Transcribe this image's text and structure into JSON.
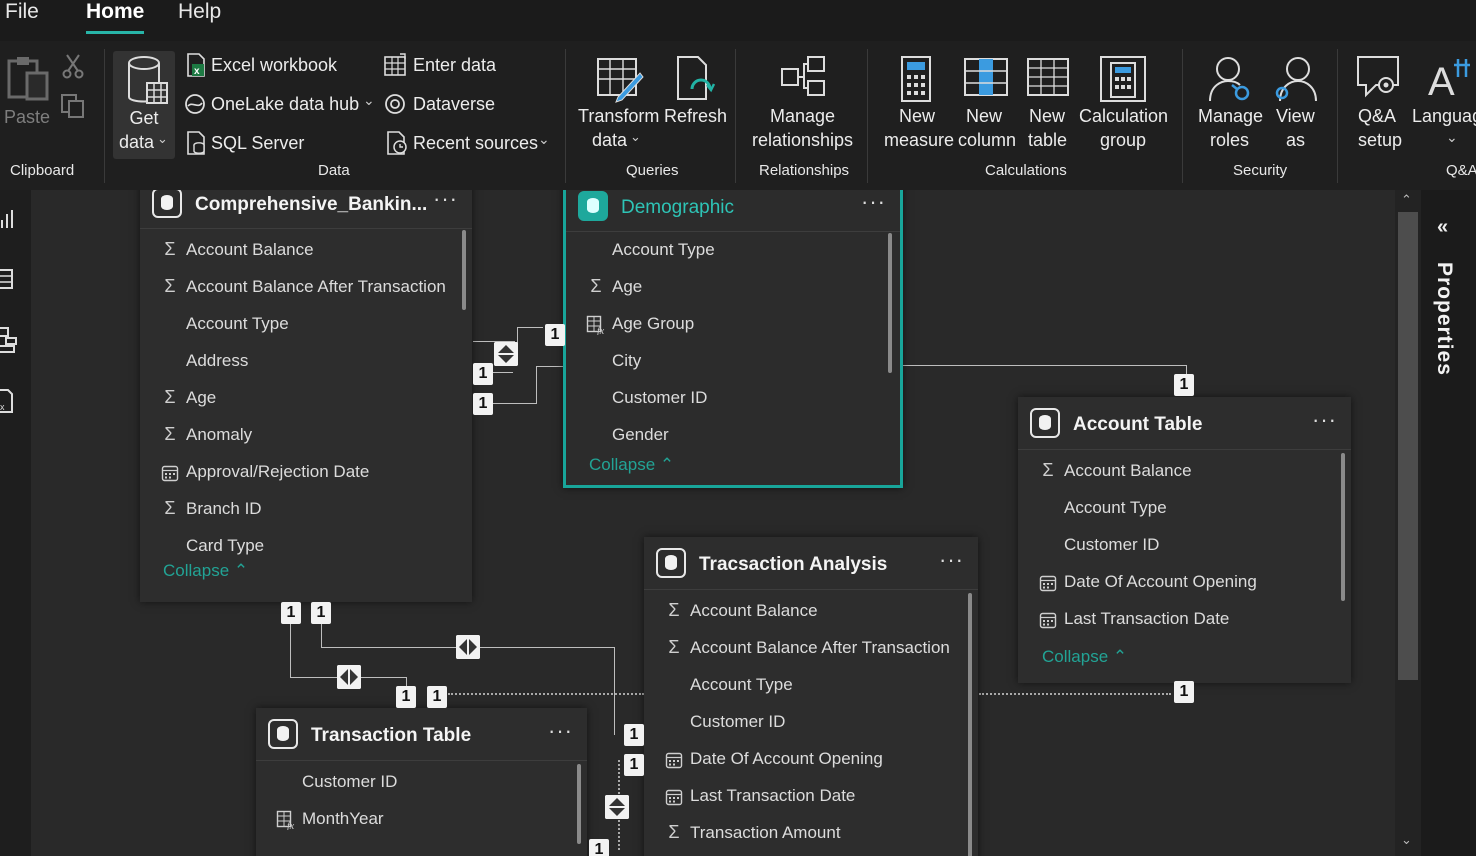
{
  "menu": {
    "file": "File",
    "home": "Home",
    "help": "Help"
  },
  "ribbon": {
    "clipboard": {
      "paste": "Paste",
      "label": "Clipboard"
    },
    "data": {
      "get_data_1": "Get",
      "get_data_2": "data",
      "excel": "Excel workbook",
      "onelake": "OneLake data hub",
      "sql": "SQL Server",
      "enter": "Enter data",
      "dataverse": "Dataverse",
      "recent": "Recent sources",
      "label": "Data"
    },
    "queries": {
      "transform_1": "Transform",
      "transform_2": "data",
      "refresh": "Refresh",
      "label": "Queries"
    },
    "relationships": {
      "manage_1": "Manage",
      "manage_2": "relationships",
      "label": "Relationships"
    },
    "calculations": {
      "new_measure_1": "New",
      "new_measure_2": "measure",
      "new_column_1": "New",
      "new_column_2": "column",
      "new_table_1": "New",
      "new_table_2": "table",
      "calc_group_1": "Calculation",
      "calc_group_2": "group",
      "label": "Calculations"
    },
    "security": {
      "manage_roles_1": "Manage",
      "manage_roles_2": "roles",
      "view_as_1": "View",
      "view_as_2": "as",
      "label": "Security"
    },
    "qa": {
      "qa_setup_1": "Q&A",
      "qa_setup_2": "setup",
      "language": "Languag",
      "label": "Q&A"
    }
  },
  "properties_label": "Properties",
  "tables": {
    "comprehensive": {
      "title": "Comprehensive_Bankin...",
      "fields": [
        {
          "icon": "sigma",
          "name": "Account Balance"
        },
        {
          "icon": "sigma",
          "name": "Account Balance After Transaction"
        },
        {
          "icon": "none",
          "name": "Account Type"
        },
        {
          "icon": "none",
          "name": "Address"
        },
        {
          "icon": "sigma",
          "name": "Age"
        },
        {
          "icon": "sigma",
          "name": "Anomaly"
        },
        {
          "icon": "calendar",
          "name": "Approval/Rejection Date"
        },
        {
          "icon": "sigma",
          "name": "Branch ID"
        },
        {
          "icon": "none",
          "name": "Card Type"
        }
      ],
      "collapse": "Collapse"
    },
    "demographic": {
      "title": "Demographic",
      "fields": [
        {
          "icon": "none",
          "name": "Account Type"
        },
        {
          "icon": "sigma",
          "name": "Age"
        },
        {
          "icon": "calc-column",
          "name": "Age Group"
        },
        {
          "icon": "none",
          "name": "City"
        },
        {
          "icon": "none",
          "name": "Customer ID"
        },
        {
          "icon": "none",
          "name": "Gender"
        }
      ],
      "collapse": "Collapse"
    },
    "account": {
      "title": "Account Table",
      "fields": [
        {
          "icon": "sigma",
          "name": "Account Balance"
        },
        {
          "icon": "none",
          "name": "Account Type"
        },
        {
          "icon": "none",
          "name": "Customer ID"
        },
        {
          "icon": "calendar",
          "name": "Date Of Account Opening"
        },
        {
          "icon": "calendar",
          "name": "Last Transaction Date"
        }
      ],
      "collapse": "Collapse"
    },
    "analysis": {
      "title": "Tracsaction Analysis",
      "fields": [
        {
          "icon": "sigma",
          "name": "Account Balance"
        },
        {
          "icon": "sigma",
          "name": "Account Balance After Transaction"
        },
        {
          "icon": "none",
          "name": "Account Type"
        },
        {
          "icon": "none",
          "name": "Customer ID"
        },
        {
          "icon": "calendar",
          "name": "Date Of Account Opening"
        },
        {
          "icon": "calendar",
          "name": "Last Transaction Date"
        },
        {
          "icon": "sigma",
          "name": "Transaction Amount"
        }
      ]
    },
    "transaction": {
      "title": "Transaction Table",
      "fields": [
        {
          "icon": "none",
          "name": "Customer ID"
        },
        {
          "icon": "calc-column",
          "name": "MonthYear"
        }
      ]
    }
  },
  "cardinality": "1"
}
